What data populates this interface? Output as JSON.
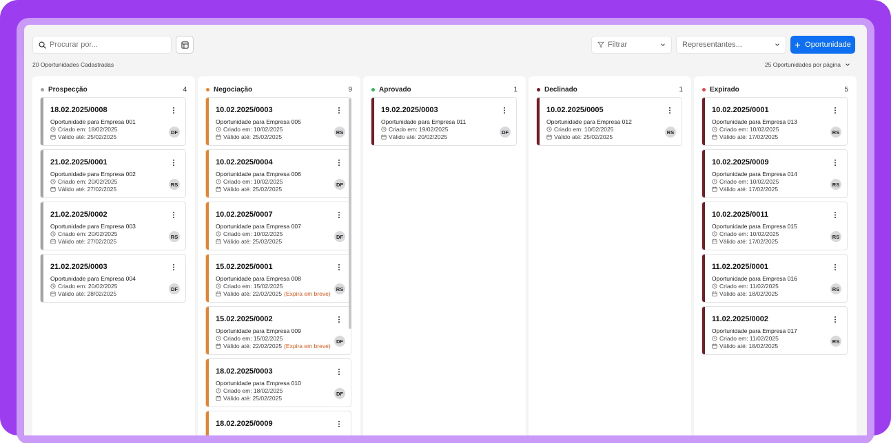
{
  "search": {
    "placeholder": "Procurar por..."
  },
  "toolbar": {
    "filter_label": "Filtrar",
    "rep_placeholder": "Representantes...",
    "new_label": "Oportunidade"
  },
  "summary": {
    "count_label": "20 Oportunidades Cadastradas",
    "per_page_label": "25 Oportunidades por página"
  },
  "colors": {
    "prospeccao": "#a3a3a6",
    "negociacao": "#f2811d",
    "aprovado": "#2fb85a",
    "declinado": "#7a1a22",
    "expirado": "#ef4444",
    "primary": "#0f6ff2"
  },
  "columns": [
    {
      "key": "prospeccao",
      "title": "Prospecção",
      "count": "4",
      "cards": [
        {
          "code": "18.02.2025/0008",
          "company": "Oportunidade para Empresa 001",
          "created": "Criado em: 18/02/2025",
          "valid": "Válido até: 25/02/2025",
          "badge": "",
          "rep": "DF"
        },
        {
          "code": "21.02.2025/0001",
          "company": "Oportunidade para Empresa 002",
          "created": "Criado em: 20/02/2025",
          "valid": "Válido até: 27/02/2025",
          "badge": "",
          "rep": "RS"
        },
        {
          "code": "21.02.2025/0002",
          "company": "Oportunidade para Empresa 003",
          "created": "Criado em: 20/02/2025",
          "valid": "Válido até: 27/02/2025",
          "badge": "",
          "rep": "RS"
        },
        {
          "code": "21.02.2025/0003",
          "company": "Oportunidade para Empresa 004",
          "created": "Criado em: 20/02/2025",
          "valid": "Válido até: 28/02/2025",
          "badge": "",
          "rep": "DF"
        }
      ]
    },
    {
      "key": "negociacao",
      "title": "Negociação",
      "count": "9",
      "cards": [
        {
          "code": "10.02.2025/0003",
          "company": "Oportunidade para Empresa 005",
          "created": "Criado em: 10/02/2025",
          "valid": "Válido até: 25/02/2025",
          "badge": "",
          "rep": "RS"
        },
        {
          "code": "10.02.2025/0004",
          "company": "Oportunidade para Empresa 006",
          "created": "Criado em: 10/02/2025",
          "valid": "Válido até: 25/02/2025",
          "badge": "",
          "rep": "DF"
        },
        {
          "code": "10.02.2025/0007",
          "company": "Oportunidade para Empresa 007",
          "created": "Criado em: 10/02/2025",
          "valid": "Válido até: 25/02/2025",
          "badge": "",
          "rep": "DF"
        },
        {
          "code": "15.02.2025/0001",
          "company": "Oportunidade para Empresa 008",
          "created": "Criado em: 15/02/2025",
          "valid": "Válido até: 22/02/2025",
          "badge": "(Expira em breve)",
          "rep": "RS"
        },
        {
          "code": "15.02.2025/0002",
          "company": "Oportunidade para Empresa 009",
          "created": "Criado em: 15/02/2025",
          "valid": "Válido até: 22/02/2025",
          "badge": "(Expira em breve)",
          "rep": "DF"
        },
        {
          "code": "18.02.2025/0003",
          "company": "Oportunidade para Empresa 010",
          "created": "Criado em: 18/02/2025",
          "valid": "Válido até: 25/02/2025",
          "badge": "",
          "rep": "DF"
        },
        {
          "code": "18.02.2025/0009",
          "company": "",
          "created": "",
          "valid": "",
          "badge": "",
          "rep": ""
        }
      ]
    },
    {
      "key": "aprovado",
      "title": "Aprovado",
      "count": "1",
      "cards": [
        {
          "code": "19.02.2025/0003",
          "company": "Oportunidade para Empresa 011",
          "created": "Criado em: 19/02/2025",
          "valid": "Válido até: 20/02/2025",
          "badge": "",
          "rep": "DF"
        }
      ]
    },
    {
      "key": "declinado",
      "title": "Declinado",
      "count": "1",
      "cards": [
        {
          "code": "10.02.2025/0005",
          "company": "Oportunidade para Empresa 012",
          "created": "Criado em: 10/02/2025",
          "valid": "Válido até: 25/02/2025",
          "badge": "",
          "rep": "RS"
        }
      ]
    },
    {
      "key": "expirado",
      "title": "Expirado",
      "count": "5",
      "cards": [
        {
          "code": "10.02.2025/0001",
          "company": "Oportunidade para Empresa 013",
          "created": "Criado em: 10/02/2025",
          "valid": "Válido até: 17/02/2025",
          "badge": "",
          "rep": "RS"
        },
        {
          "code": "10.02.2025/0009",
          "company": "Oportunidade para Empresa 014",
          "created": "Criado em: 10/02/2025",
          "valid": "Válido até: 17/02/2025",
          "badge": "",
          "rep": "RS"
        },
        {
          "code": "10.02.2025/0011",
          "company": "Oportunidade para Empresa 015",
          "created": "Criado em: 10/02/2025",
          "valid": "Válido até: 17/02/2025",
          "badge": "",
          "rep": "RS"
        },
        {
          "code": "11.02.2025/0001",
          "company": "Oportunidade para Empresa 016",
          "created": "Criado em: 11/02/2025",
          "valid": "Válido até: 18/02/2025",
          "badge": "",
          "rep": "RS"
        },
        {
          "code": "11.02.2025/0002",
          "company": "Oportunidade para Empresa 017",
          "created": "Criado em: 11/02/2025",
          "valid": "Válido até: 18/02/2025",
          "badge": "",
          "rep": "RS"
        }
      ]
    }
  ]
}
